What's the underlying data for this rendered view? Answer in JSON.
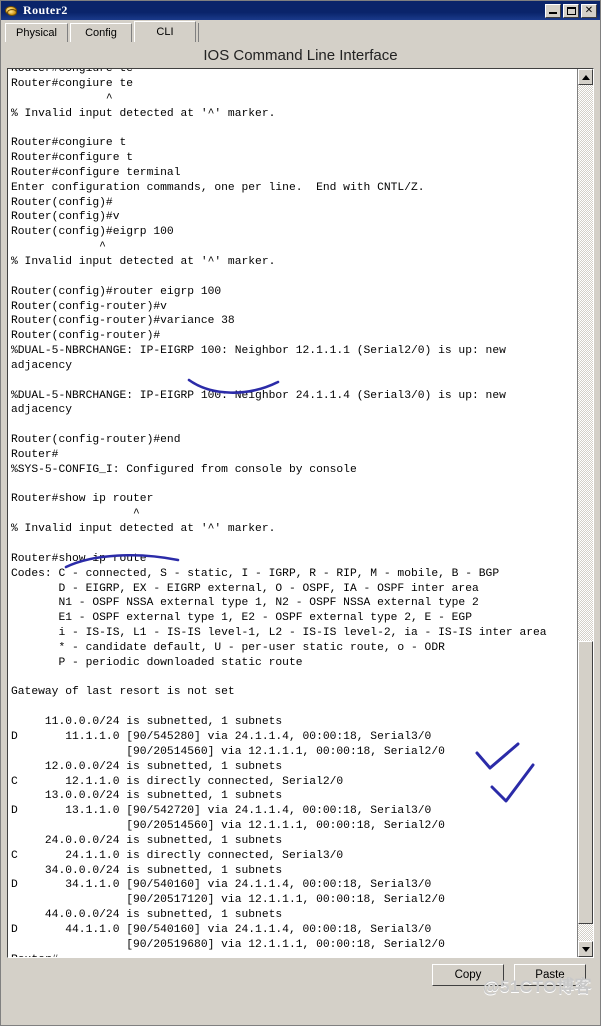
{
  "window": {
    "title": "Router2",
    "icon": "router-device-icon",
    "minimize_label": "Minimize",
    "maximize_label": "Maximize",
    "close_label": "✕"
  },
  "tabs": [
    {
      "label": "Physical",
      "active": false
    },
    {
      "label": "Config",
      "active": false
    },
    {
      "label": "CLI",
      "active": true
    }
  ],
  "panel": {
    "header": "IOS Command Line Interface"
  },
  "terminal": {
    "content": "Router#congiure te\nRouter#congiure te\n              ^\n% Invalid input detected at '^' marker.\n\nRouter#congiure t\nRouter#configure t\nRouter#configure terminal\nEnter configuration commands, one per line.  End with CNTL/Z.\nRouter(config)#\nRouter(config)#v\nRouter(config)#eigrp 100\n             ^\n% Invalid input detected at '^' marker.\n\nRouter(config)#router eigrp 100\nRouter(config-router)#v\nRouter(config-router)#variance 38\nRouter(config-router)#\n%DUAL-5-NBRCHANGE: IP-EIGRP 100: Neighbor 12.1.1.1 (Serial2/0) is up: new\nadjacency\n\n%DUAL-5-NBRCHANGE: IP-EIGRP 100: Neighbor 24.1.1.4 (Serial3/0) is up: new\nadjacency\n\nRouter(config-router)#end\nRouter#\n%SYS-5-CONFIG_I: Configured from console by console\n\nRouter#show ip router\n                  ^\n% Invalid input detected at '^' marker.\n\nRouter#show ip route\nCodes: C - connected, S - static, I - IGRP, R - RIP, M - mobile, B - BGP\n       D - EIGRP, EX - EIGRP external, O - OSPF, IA - OSPF inter area\n       N1 - OSPF NSSA external type 1, N2 - OSPF NSSA external type 2\n       E1 - OSPF external type 1, E2 - OSPF external type 2, E - EGP\n       i - IS-IS, L1 - IS-IS level-1, L2 - IS-IS level-2, ia - IS-IS inter area\n       * - candidate default, U - per-user static route, o - ODR\n       P - periodic downloaded static route\n\nGateway of last resort is not set\n\n     11.0.0.0/24 is subnetted, 1 subnets\nD       11.1.1.0 [90/545280] via 24.1.1.4, 00:00:18, Serial3/0\n                 [90/20514560] via 12.1.1.1, 00:00:18, Serial2/0\n     12.0.0.0/24 is subnetted, 1 subnets\nC       12.1.1.0 is directly connected, Serial2/0\n     13.0.0.0/24 is subnetted, 1 subnets\nD       13.1.1.0 [90/542720] via 24.1.1.4, 00:00:18, Serial3/0\n                 [90/20514560] via 12.1.1.1, 00:00:18, Serial2/0\n     24.0.0.0/24 is subnetted, 1 subnets\nC       24.1.1.0 is directly connected, Serial3/0\n     34.0.0.0/24 is subnetted, 1 subnets\nD       34.1.1.0 [90/540160] via 24.1.1.4, 00:00:18, Serial3/0\n                 [90/20517120] via 12.1.1.1, 00:00:18, Serial2/0\n     44.0.0.0/24 is subnetted, 1 subnets\nD       44.1.1.0 [90/540160] via 24.1.1.4, 00:00:18, Serial3/0\n                 [90/20519680] via 12.1.1.1, 00:00:18, Serial2/0\nRouter#\nRouter#\nRouter#show ip route\nRouter#"
  },
  "annotations": {
    "pen_color": "#2b2ba8",
    "marks": [
      {
        "name": "underline-variance-38",
        "type": "underline"
      },
      {
        "name": "underline-show-ip-router",
        "type": "underline"
      },
      {
        "name": "checkmark-route-upper",
        "type": "check"
      },
      {
        "name": "checkmark-route-lower",
        "type": "check"
      }
    ]
  },
  "scrollbar": {
    "up_arrow": "scroll-up-arrow",
    "down_arrow": "scroll-down-arrow"
  },
  "buttons": {
    "copy": "Copy",
    "paste": "Paste"
  },
  "watermark": "@51CTO博客"
}
